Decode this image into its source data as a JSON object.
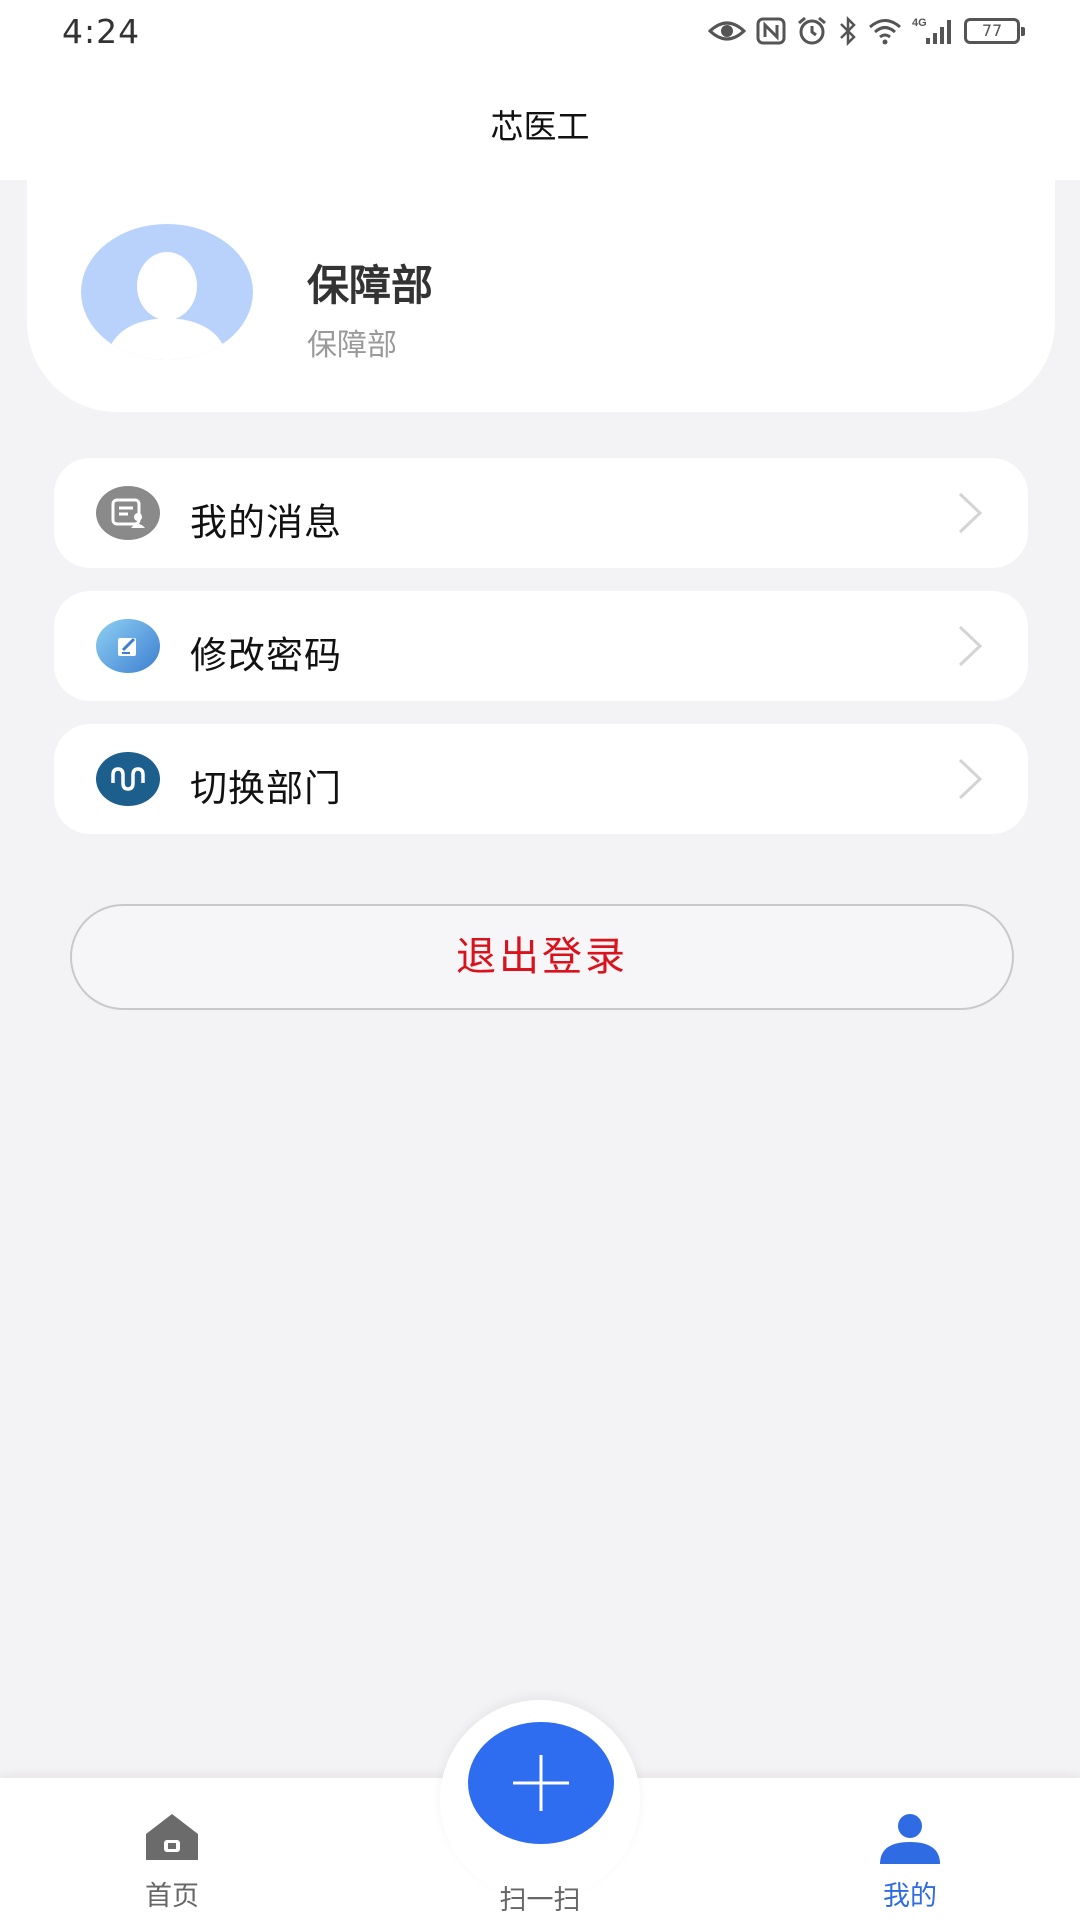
{
  "status_bar": {
    "time": "4:24",
    "battery": "77",
    "network": "4G",
    "icons": [
      "eye-icon",
      "nfc-icon",
      "alarm-icon",
      "bluetooth-icon",
      "wifi-icon",
      "signal-icon",
      "battery-icon"
    ]
  },
  "header": {
    "title": "芯医工"
  },
  "profile": {
    "name": "保障部",
    "department": "保障部",
    "avatar_color": "#b8d2fb"
  },
  "menu": {
    "items": [
      {
        "label": "我的消息",
        "icon": "message-icon",
        "icon_color": "#8a8a8a"
      },
      {
        "label": "修改密码",
        "icon": "edit-password-icon",
        "icon_color": "#5aa6e6"
      },
      {
        "label": "切换部门",
        "icon": "switch-department-icon",
        "icon_color": "#1c5f8c"
      }
    ]
  },
  "logout": {
    "label": "退出登录",
    "color": "#d9121b"
  },
  "bottom_nav": {
    "home_label": "首页",
    "scan_label": "扫一扫",
    "mine_label": "我的",
    "active_color": "#2f6be3",
    "scan_color": "#2e6cf0"
  }
}
